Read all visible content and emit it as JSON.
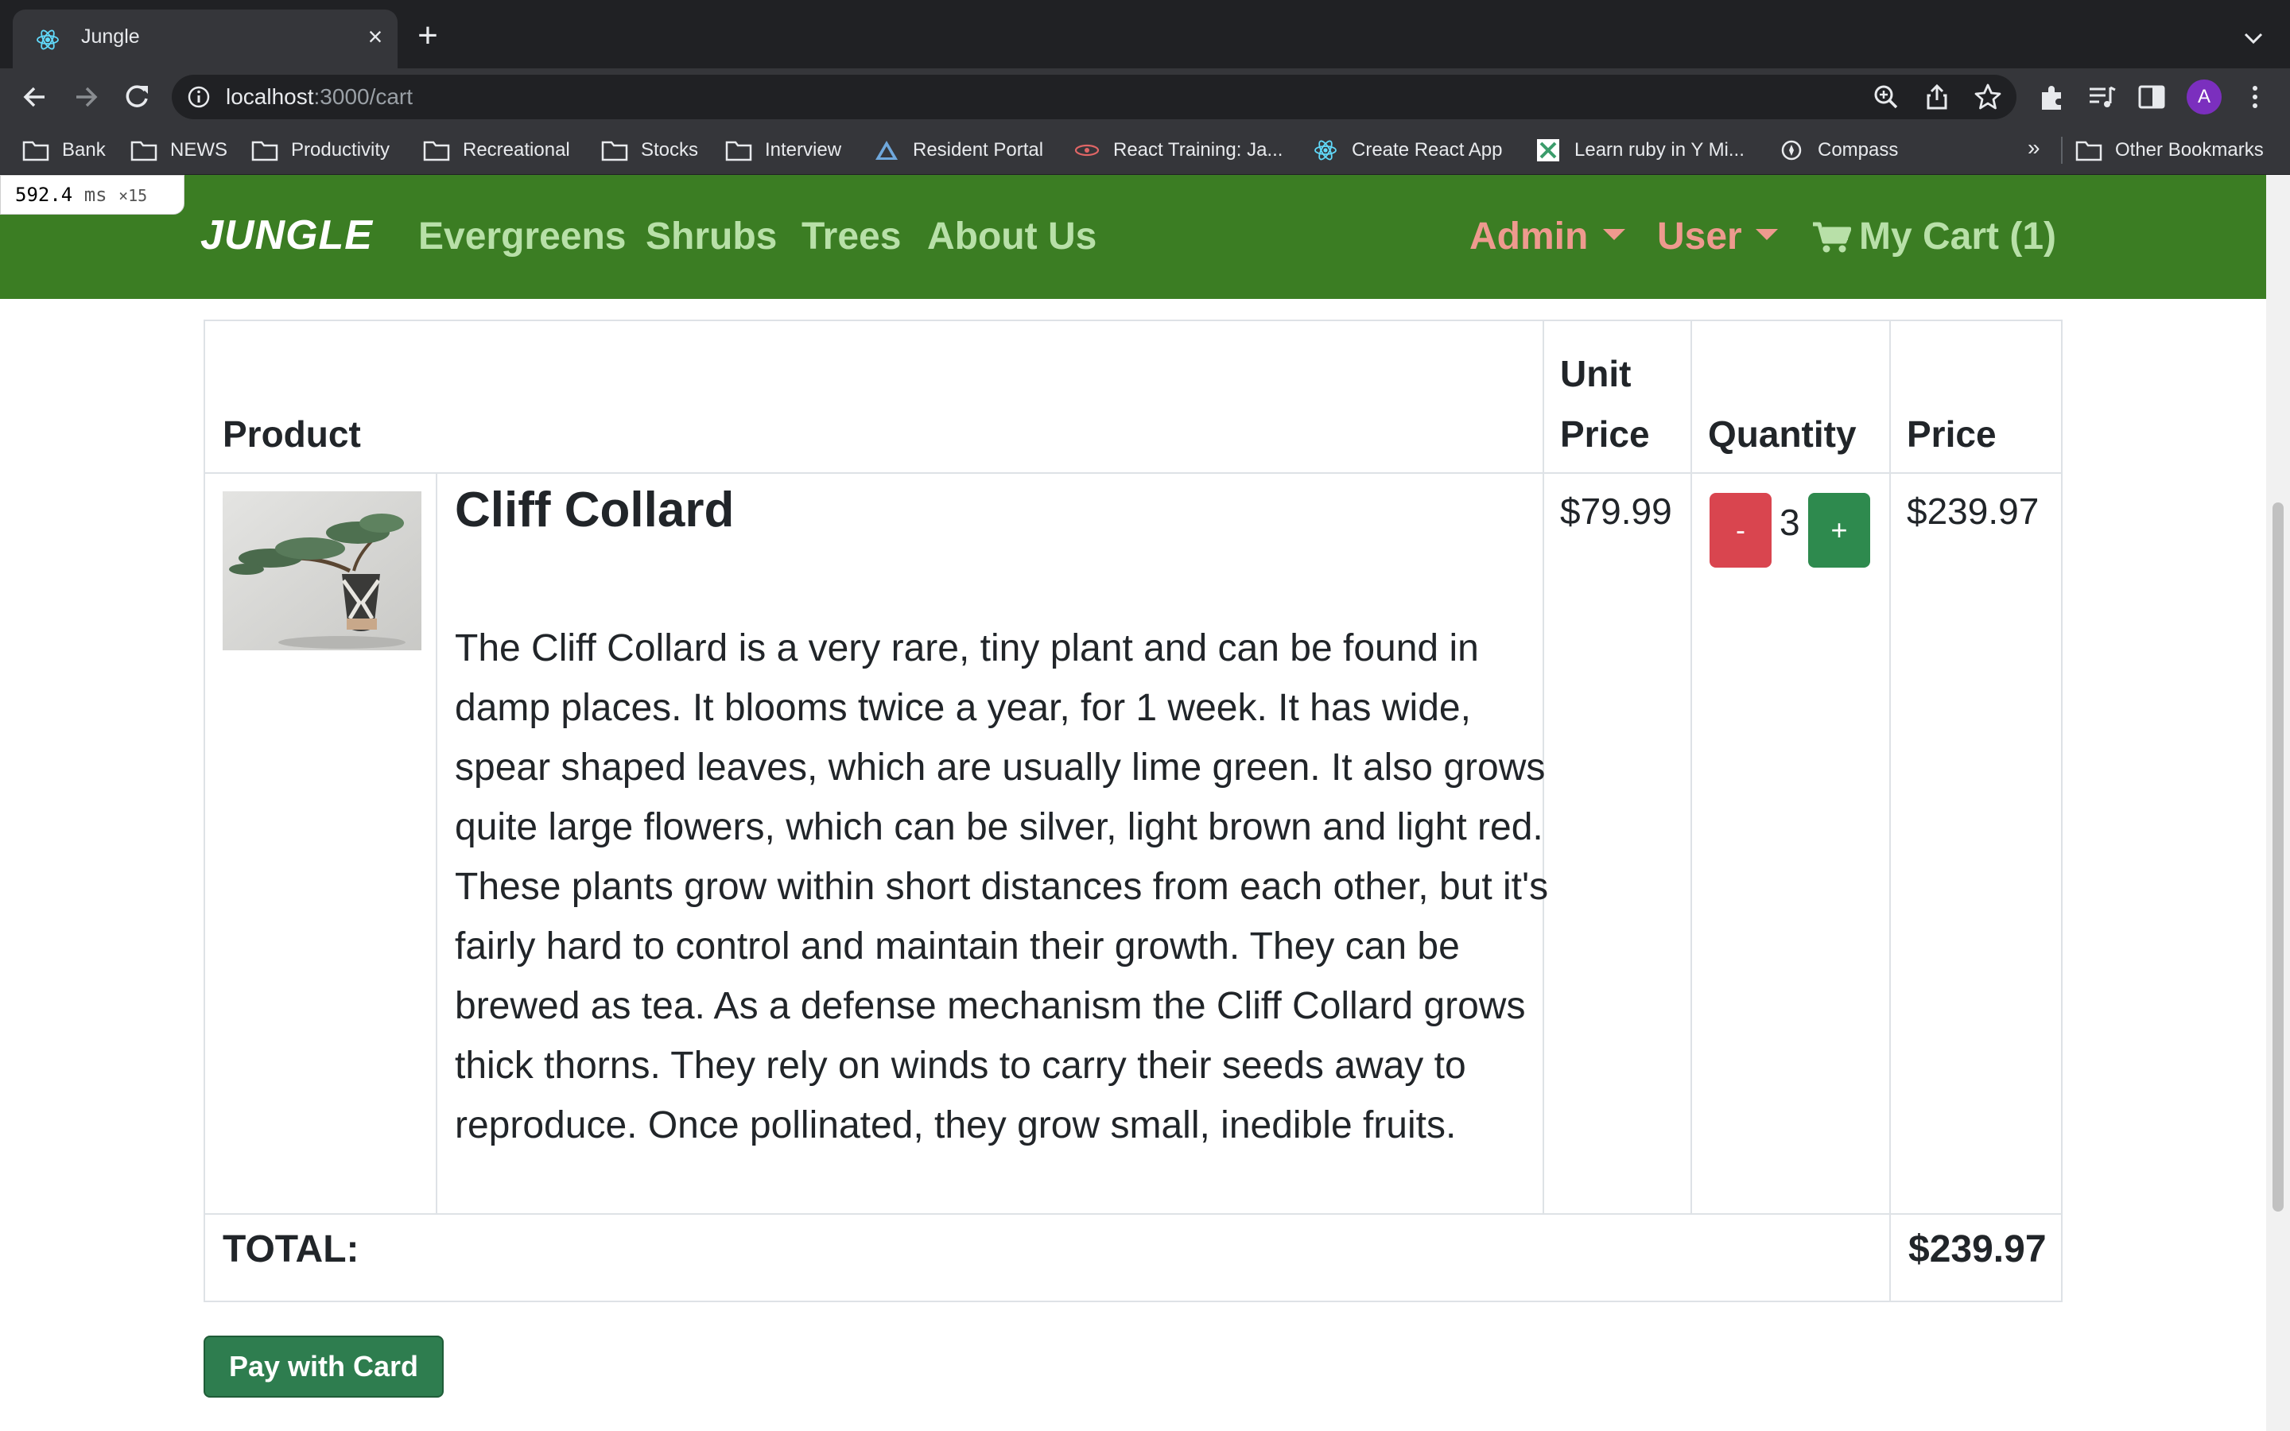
{
  "browser": {
    "tab_title": "Jungle",
    "url_host": "localhost",
    "url_path": ":3000/cart",
    "avatar_letter": "A",
    "bookmarks": [
      {
        "label": "Bank",
        "icon": "folder-icon"
      },
      {
        "label": "NEWS",
        "icon": "folder-icon"
      },
      {
        "label": "Productivity",
        "icon": "folder-icon"
      },
      {
        "label": "Recreational",
        "icon": "folder-icon"
      },
      {
        "label": "Stocks",
        "icon": "folder-icon"
      },
      {
        "label": "Interview",
        "icon": "folder-icon"
      },
      {
        "label": "Resident Portal",
        "icon": "site-icon"
      },
      {
        "label": "React Training: Ja...",
        "icon": "site-icon"
      },
      {
        "label": "Create React App",
        "icon": "react-icon"
      },
      {
        "label": "Learn ruby in Y Mi...",
        "icon": "site-icon"
      },
      {
        "label": "Compass",
        "icon": "compass-icon"
      }
    ],
    "bookmarks_overflow": "»",
    "other_bookmarks": "Other Bookmarks"
  },
  "perf_overlay": {
    "value": "592.4",
    "unit": "ms",
    "multiplier": "×15"
  },
  "navbar": {
    "brand": "JUNGLE",
    "links": [
      "Evergreens",
      "Shrubs",
      "Trees",
      "About Us"
    ],
    "admin_label": "Admin",
    "user_label": "User",
    "cart_label": "My Cart (1)",
    "color": "#3b7d23"
  },
  "cart": {
    "headers": {
      "product": "Product",
      "unit_price_1": "Unit",
      "unit_price_2": "Price",
      "quantity": "Quantity",
      "price": "Price"
    },
    "item": {
      "name": "Cliff Collard",
      "description": "The Cliff Collard is a very rare, tiny plant and can be found in damp places. It blooms twice a year, for 1 week. It has wide, spear shaped leaves, which are usually lime green. It also grows quite large flowers, which can be silver, light brown and light red. These plants grow within short distances from each other, but it's fairly hard to control and maintain their growth. They can be brewed as tea. As a defense mechanism the Cliff Collard grows thick thorns. They rely on winds to carry their seeds away to reproduce. Once pollinated, they grow small, inedible fruits.",
      "unit_price": "$79.99",
      "quantity": "3",
      "minus_label": "-",
      "plus_label": "+",
      "price": "$239.97"
    },
    "total_label": "TOTAL:",
    "total_value": "$239.97",
    "pay_button": "Pay with Card"
  }
}
